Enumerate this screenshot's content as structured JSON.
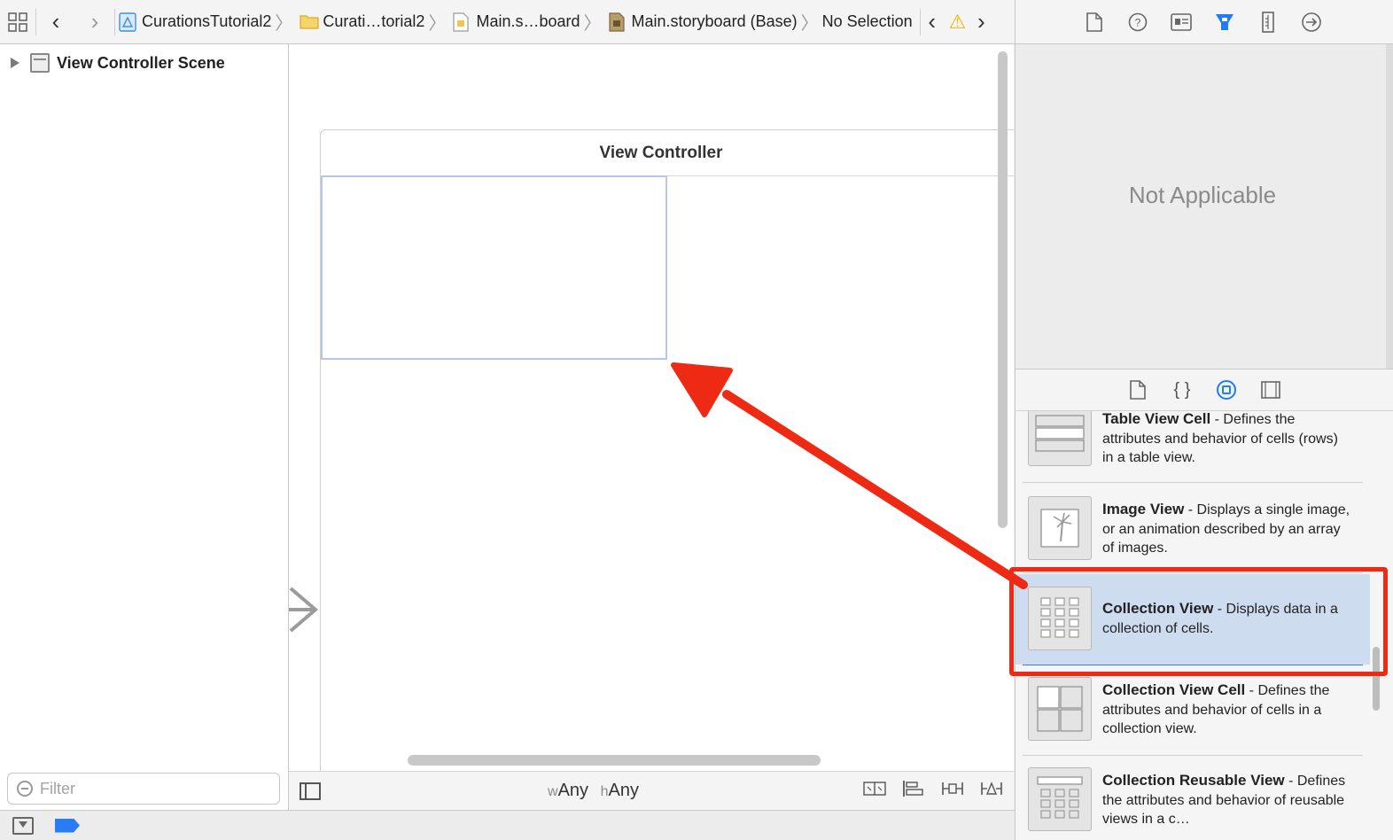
{
  "jumpbar": {
    "crumbs": [
      "CurationsTutorial2",
      "Curati…torial2",
      "Main.s…board",
      "Main.storyboard (Base)",
      "No Selection"
    ]
  },
  "inspector_toolbar": {
    "icons": [
      "file-inspector-icon",
      "quick-help-icon",
      "identity-inspector-icon",
      "attributes-inspector-icon",
      "size-inspector-icon",
      "connections-inspector-icon"
    ],
    "active": "attributes-inspector-icon",
    "active_color": "#1e7cf6"
  },
  "outline": {
    "scene_label": "View Controller Scene",
    "filter_placeholder": "Filter"
  },
  "canvas": {
    "controller_title": "View Controller",
    "size_class_w_prefix": "w",
    "size_class_w": "Any",
    "size_class_h_prefix": "h",
    "size_class_h": "Any"
  },
  "inspector": {
    "empty_message": "Not Applicable"
  },
  "library": {
    "active_tab": "object-library-icon",
    "items": [
      {
        "title": "Table View Cell",
        "sep": " - ",
        "desc": "Defines the attributes and behavior of cells (rows) in a table view."
      },
      {
        "title": "Image View",
        "sep": " - ",
        "desc": "Displays a single image, or an animation described by an array of images."
      },
      {
        "title": "Collection View",
        "sep": " - ",
        "desc": "Displays data in a collection of cells.",
        "selected": true
      },
      {
        "title": "Collection View Cell",
        "sep": " - ",
        "desc": "Defines the attributes and behavior of cells in a collection view."
      },
      {
        "title": "Collection Reusable View",
        "sep": " - ",
        "desc": "Defines the attributes and behavior of reusable views in a c…"
      }
    ]
  },
  "annotation": {
    "color": "#ef2a14"
  }
}
